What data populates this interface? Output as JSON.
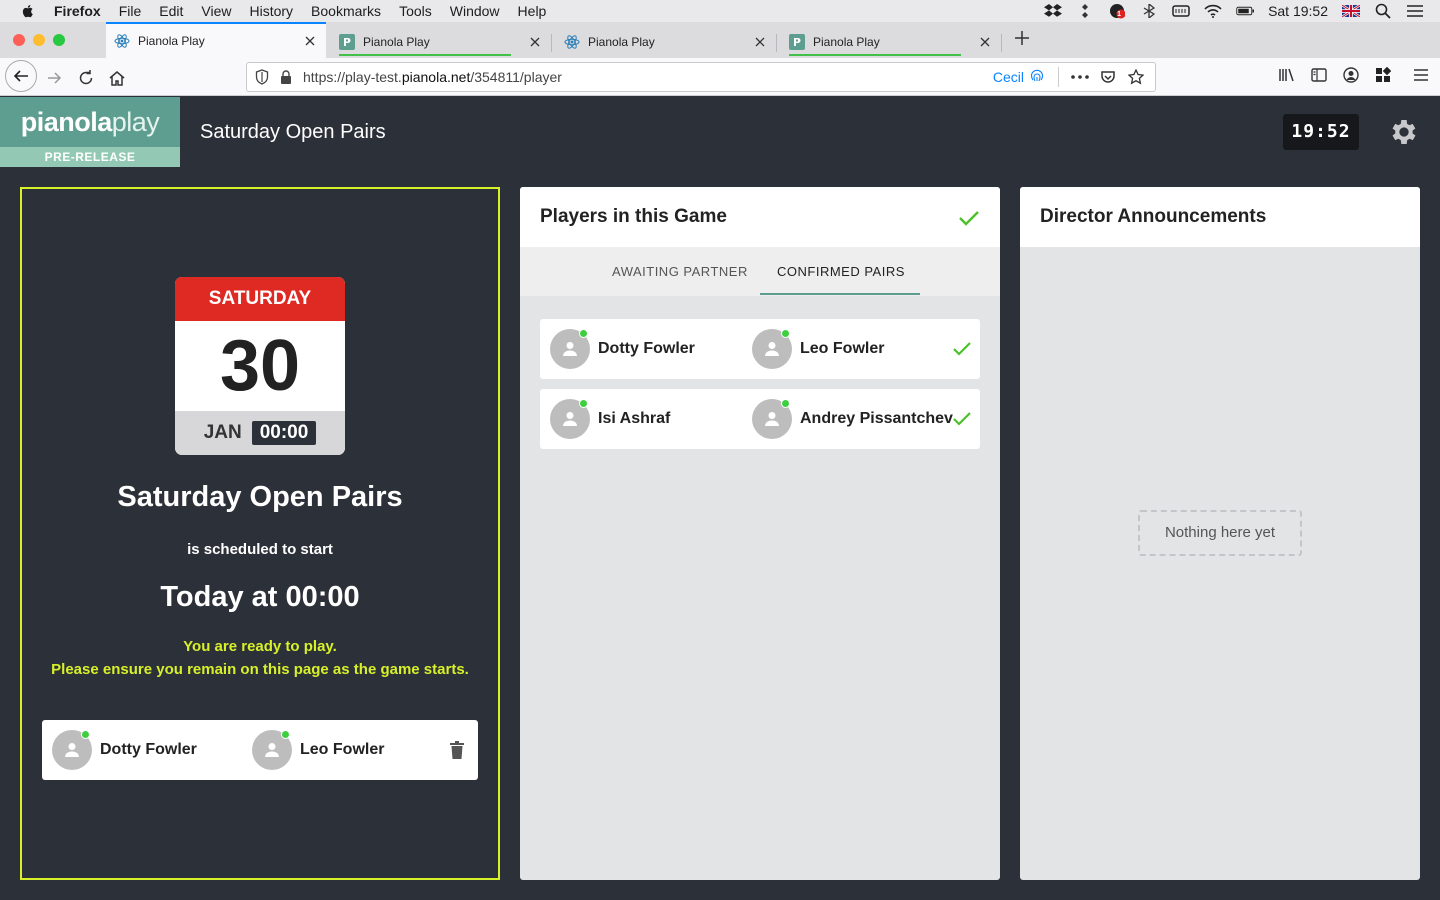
{
  "menubar": {
    "app": "Firefox",
    "items": [
      "File",
      "Edit",
      "View",
      "History",
      "Bookmarks",
      "Tools",
      "Window",
      "Help"
    ],
    "clock": "Sat 19:52",
    "badge": "1"
  },
  "tabs": [
    {
      "label": "Pianola Play",
      "active": true
    },
    {
      "label": "Pianola Play",
      "active": false
    },
    {
      "label": "Pianola Play",
      "active": false
    },
    {
      "label": "Pianola Play",
      "active": false
    }
  ],
  "urlbar": {
    "url_prefix": "https://play-test.",
    "url_host": "pianola.net",
    "url_path": "/354811/player",
    "profile": "Cecil"
  },
  "app": {
    "logo_bold": "pianola",
    "logo_light": "play",
    "logo_badge": "PRE-RELEASE",
    "title": "Saturday Open Pairs",
    "time": "19:52"
  },
  "event": {
    "day": "SATURDAY",
    "date": "30",
    "month": "JAN",
    "start_time": "00:00",
    "name": "Saturday Open Pairs",
    "scheduled": "is scheduled to start",
    "when": "Today at 00:00",
    "ready_line1": "You are ready to play.",
    "ready_line2": "Please ensure you remain on this page as the game starts.",
    "my_pair": [
      "Dotty Fowler",
      "Leo Fowler"
    ]
  },
  "players_panel": {
    "title": "Players in this Game",
    "tabs": [
      "AWAITING PARTNER",
      "CONFIRMED PAIRS"
    ],
    "active_tab": 1,
    "pairs": [
      [
        "Dotty Fowler",
        "Leo Fowler"
      ],
      [
        "Isi Ashraf",
        "Andrey Pissantchev"
      ]
    ]
  },
  "announcements": {
    "title": "Director Announcements",
    "empty": "Nothing here yet"
  },
  "colors": {
    "accent_yellow": "#d7f02a",
    "brand_green": "#5e9e90",
    "calendar_red": "#de2a22",
    "online_dot": "#3ecf3e",
    "check_green": "#4cc22a"
  }
}
